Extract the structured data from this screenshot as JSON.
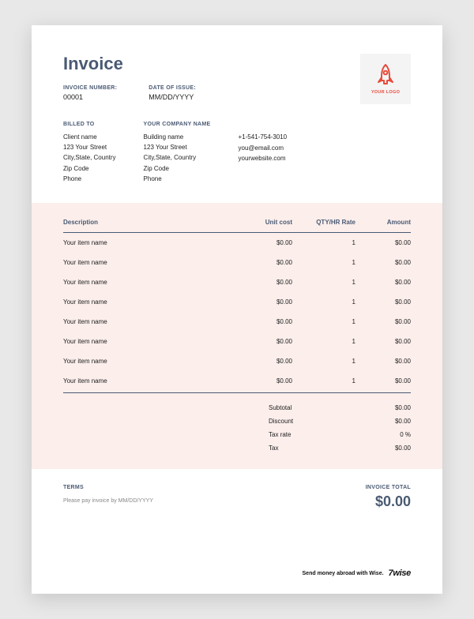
{
  "title": "Invoice",
  "meta": {
    "invoice_number_label": "INVOICE NUMBER:",
    "invoice_number": "00001",
    "date_label": "DATE OF ISSUE:",
    "date": "MM/DD/YYYY"
  },
  "logo": {
    "text": "YOUR LOGO"
  },
  "billed_to": {
    "label": "BILLED TO",
    "lines": [
      "Client name",
      "123 Your Street",
      "City,State, Country",
      "Zip Code",
      "Phone"
    ]
  },
  "company": {
    "label": "YOUR COMPANY NAME",
    "lines": [
      "Building name",
      "123 Your Street",
      "City,State, Country",
      "Zip Code",
      "Phone"
    ]
  },
  "contact": {
    "lines": [
      "+1-541-754-3010",
      "you@email.com",
      "yourwebsite.com"
    ]
  },
  "table": {
    "headers": {
      "desc": "Description",
      "cost": "Unit cost",
      "qty": "QTY/HR Rate",
      "amt": "Amount"
    },
    "rows": [
      {
        "desc": "Your item name",
        "cost": "$0.00",
        "qty": "1",
        "amt": "$0.00"
      },
      {
        "desc": "Your item name",
        "cost": "$0.00",
        "qty": "1",
        "amt": "$0.00"
      },
      {
        "desc": "Your item name",
        "cost": "$0.00",
        "qty": "1",
        "amt": "$0.00"
      },
      {
        "desc": "Your item name",
        "cost": "$0.00",
        "qty": "1",
        "amt": "$0.00"
      },
      {
        "desc": "Your item name",
        "cost": "$0.00",
        "qty": "1",
        "amt": "$0.00"
      },
      {
        "desc": "Your item name",
        "cost": "$0.00",
        "qty": "1",
        "amt": "$0.00"
      },
      {
        "desc": "Your item name",
        "cost": "$0.00",
        "qty": "1",
        "amt": "$0.00"
      },
      {
        "desc": "Your item name",
        "cost": "$0.00",
        "qty": "1",
        "amt": "$0.00"
      }
    ]
  },
  "totals": {
    "subtotal_label": "Subtotal",
    "subtotal": "$0.00",
    "discount_label": "Discount",
    "discount": "$0.00",
    "taxrate_label": "Tax rate",
    "taxrate": "0 %",
    "tax_label": "Tax",
    "tax": "$0.00"
  },
  "terms": {
    "label": "TERMS",
    "note": "Please pay invoice by MM/DD/YYYY"
  },
  "invoice_total": {
    "label": "INVOICE TOTAL",
    "amount": "$0.00"
  },
  "brand": {
    "tagline": "Send money abroad with Wise.",
    "name": "7wise"
  }
}
